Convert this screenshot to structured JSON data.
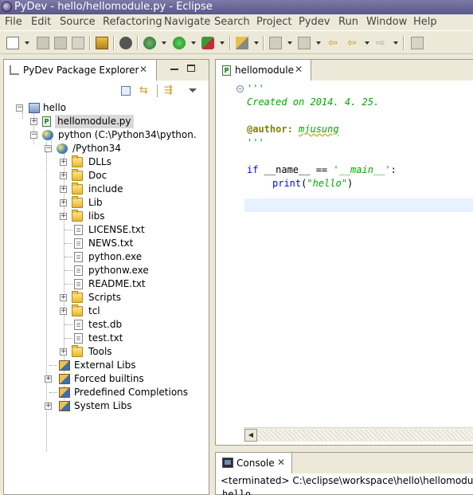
{
  "window": {
    "title": "PyDev - hello/hellomodule.py - Eclipse"
  },
  "menu": [
    "File",
    "Edit",
    "Source",
    "Refactoring",
    "Navigate",
    "Search",
    "Project",
    "Pydev",
    "Run",
    "Window",
    "Help"
  ],
  "explorer": {
    "tab_label": "PyDev Package Explorer",
    "tree": [
      {
        "label": "hello",
        "icon": "project-icon"
      },
      {
        "label": "hellomodule.py",
        "icon": "python-file-icon",
        "selected": true
      },
      {
        "label": "python  (C:\\Python34\\python.",
        "icon": "python-interpreter-icon"
      },
      {
        "label": "/Python34",
        "icon": "python-folder-icon"
      },
      {
        "label": "DLLs",
        "icon": "folder-icon"
      },
      {
        "label": "Doc",
        "icon": "folder-icon"
      },
      {
        "label": "include",
        "icon": "folder-icon"
      },
      {
        "label": "Lib",
        "icon": "folder-icon"
      },
      {
        "label": "libs",
        "icon": "folder-icon"
      },
      {
        "label": "LICENSE.txt",
        "icon": "file-icon"
      },
      {
        "label": "NEWS.txt",
        "icon": "file-icon"
      },
      {
        "label": "python.exe",
        "icon": "file-icon"
      },
      {
        "label": "pythonw.exe",
        "icon": "file-icon"
      },
      {
        "label": "README.txt",
        "icon": "file-icon"
      },
      {
        "label": "Scripts",
        "icon": "folder-icon"
      },
      {
        "label": "tcl",
        "icon": "folder-icon"
      },
      {
        "label": "test.db",
        "icon": "file-icon"
      },
      {
        "label": "test.txt",
        "icon": "file-icon"
      },
      {
        "label": "Tools",
        "icon": "folder-icon"
      },
      {
        "label": "External Libs",
        "icon": "library-icon"
      },
      {
        "label": "Forced builtins",
        "icon": "library-icon"
      },
      {
        "label": "Predefined Completions",
        "icon": "library-icon"
      },
      {
        "label": "System Libs",
        "icon": "library-icon"
      }
    ]
  },
  "editor": {
    "tab_label": "hellomodule",
    "code": {
      "line1": "'''",
      "line2": "Created on 2014. 4. 25.",
      "line4_decorator": "@author:",
      "line4_value": "mjusung",
      "line5": "'''",
      "line7_kw": "if",
      "line7_mid": " __name__ == ",
      "line7_str": "'__main__'",
      "line7_end": ":",
      "line8_kw": "print",
      "line8_open": "(",
      "line8_str": "\"hello\"",
      "line8_close": ")"
    }
  },
  "console": {
    "tab_label": "Console",
    "status": "<terminated> C:\\eclipse\\workspace\\hello\\hellomodul",
    "output": "hello"
  },
  "colors": {
    "string": "#00aa00",
    "keyword": "#0000ff",
    "decorator": "#808000",
    "current_line": "#e8f2fe"
  }
}
